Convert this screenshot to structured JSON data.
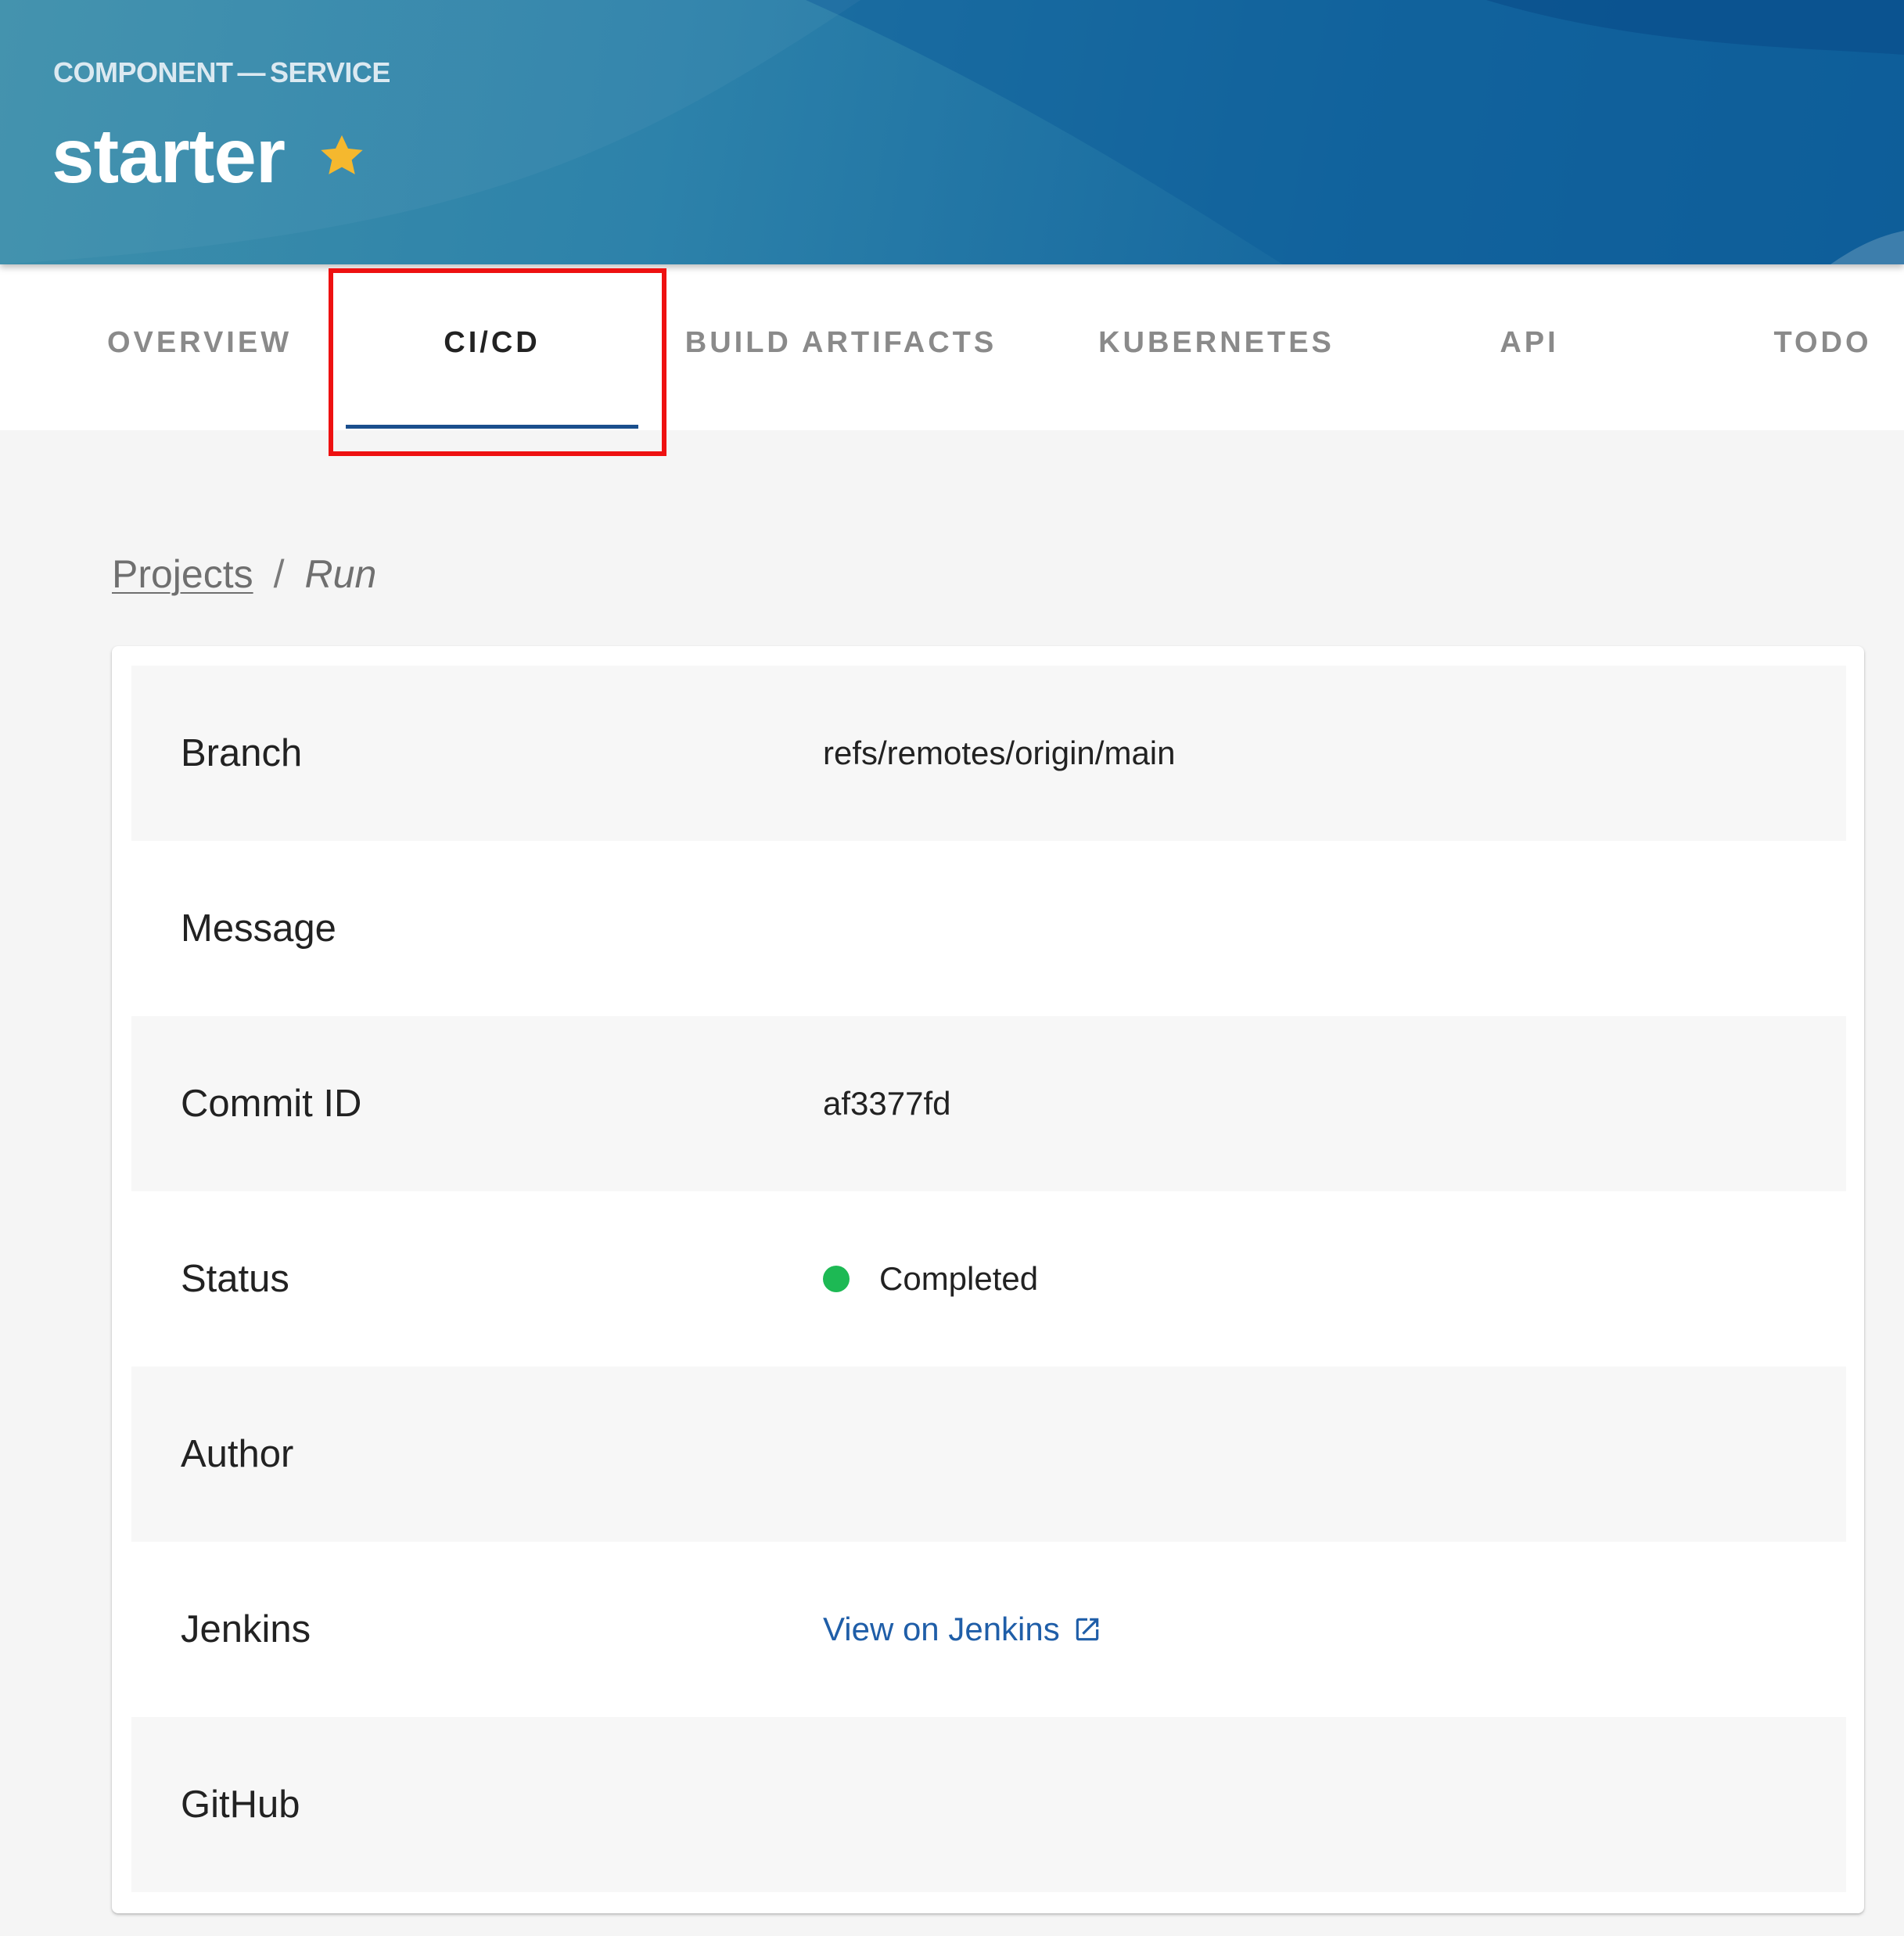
{
  "header": {
    "kind": "COMPONENT",
    "separator": "—",
    "type": "SERVICE",
    "title": "starter",
    "star_icon": "star-icon",
    "star_color": "#f5b82e"
  },
  "tabs": [
    {
      "label": "OVERVIEW",
      "active": false
    },
    {
      "label": "CI/CD",
      "active": true
    },
    {
      "label": "BUILD ARTIFACTS",
      "active": false
    },
    {
      "label": "KUBERNETES",
      "active": false
    },
    {
      "label": "API",
      "active": false
    },
    {
      "label": "TODO",
      "active": false
    }
  ],
  "breadcrumb": {
    "link": "Projects",
    "separator": "/",
    "current": "Run"
  },
  "details": {
    "branch": {
      "label": "Branch",
      "value": "refs/remotes/origin/main"
    },
    "message": {
      "label": "Message",
      "value": ""
    },
    "commit": {
      "label": "Commit ID",
      "value": "af3377fd"
    },
    "status": {
      "label": "Status",
      "value": "Completed",
      "color": "#1db954"
    },
    "author": {
      "label": "Author",
      "value": ""
    },
    "jenkins": {
      "label": "Jenkins",
      "link_text": "View on Jenkins",
      "icon": "external-link-icon"
    },
    "github": {
      "label": "GitHub",
      "value": ""
    }
  },
  "colors": {
    "accent": "#1a4f8d",
    "link": "#1f5ea8",
    "highlight": "#ee1111"
  }
}
